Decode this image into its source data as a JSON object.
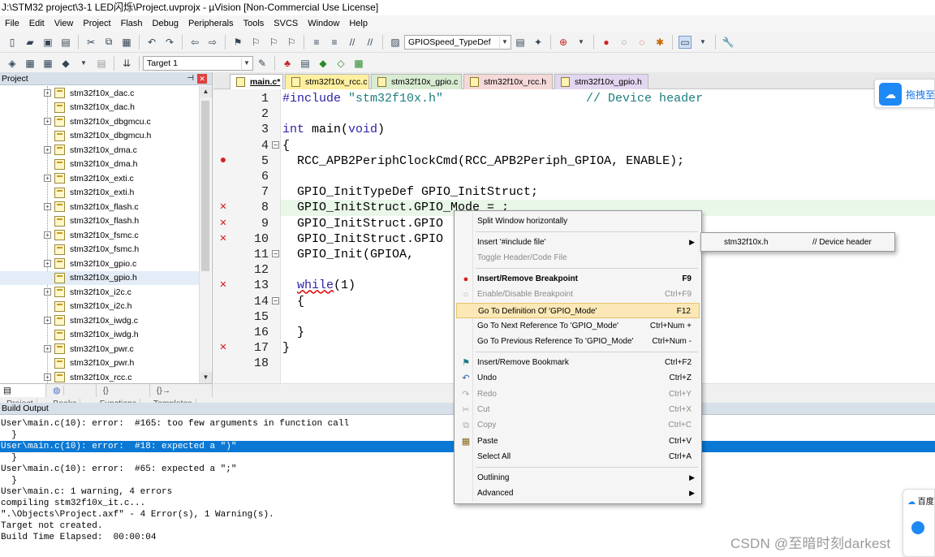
{
  "window": {
    "title": "J:\\STM32 project\\3-1 LED闪烁\\Project.uvprojx - µVision  [Non-Commercial Use License]"
  },
  "menu": [
    "File",
    "Edit",
    "View",
    "Project",
    "Flash",
    "Debug",
    "Peripherals",
    "Tools",
    "SVCS",
    "Window",
    "Help"
  ],
  "toolbar": {
    "find_combo": "GPIOSpeed_TypeDef",
    "target_combo": "Target 1"
  },
  "project_pane": {
    "title": "Project",
    "files": [
      {
        "name": "stm32f10x_dac.c",
        "expandable": true
      },
      {
        "name": "stm32f10x_dac.h",
        "expandable": false
      },
      {
        "name": "stm32f10x_dbgmcu.c",
        "expandable": true
      },
      {
        "name": "stm32f10x_dbgmcu.h",
        "expandable": false
      },
      {
        "name": "stm32f10x_dma.c",
        "expandable": true
      },
      {
        "name": "stm32f10x_dma.h",
        "expandable": false
      },
      {
        "name": "stm32f10x_exti.c",
        "expandable": true
      },
      {
        "name": "stm32f10x_exti.h",
        "expandable": false
      },
      {
        "name": "stm32f10x_flash.c",
        "expandable": true
      },
      {
        "name": "stm32f10x_flash.h",
        "expandable": false
      },
      {
        "name": "stm32f10x_fsmc.c",
        "expandable": true
      },
      {
        "name": "stm32f10x_fsmc.h",
        "expandable": false
      },
      {
        "name": "stm32f10x_gpio.c",
        "expandable": true
      },
      {
        "name": "stm32f10x_gpio.h",
        "expandable": false
      },
      {
        "name": "stm32f10x_i2c.c",
        "expandable": true
      },
      {
        "name": "stm32f10x_i2c.h",
        "expandable": false
      },
      {
        "name": "stm32f10x_iwdg.c",
        "expandable": true
      },
      {
        "name": "stm32f10x_iwdg.h",
        "expandable": false
      },
      {
        "name": "stm32f10x_pwr.c",
        "expandable": true
      },
      {
        "name": "stm32f10x_pwr.h",
        "expandable": false
      },
      {
        "name": "stm32f10x_rcc.c",
        "expandable": true
      }
    ],
    "tabs": [
      "Project",
      "Books",
      "{} Functions",
      "{}→ Templates"
    ]
  },
  "editor_tabs": [
    {
      "label": "main.c*",
      "color": "#e9e0f5",
      "active": true
    },
    {
      "label": "stm32f10x_rcc.c",
      "color": "#fff0a0",
      "active": false
    },
    {
      "label": "stm32f10x_gpio.c",
      "color": "#d8ecd2",
      "active": false
    },
    {
      "label": "stm32f10x_rcc.h",
      "color": "#f5d8d8",
      "active": false
    },
    {
      "label": "stm32f10x_gpio.h",
      "color": "#e2d6f0",
      "active": false
    }
  ],
  "code": {
    "line_numbers": [
      "1",
      "2",
      "3",
      "4",
      "5",
      "6",
      "7",
      "8",
      "9",
      "10",
      "11",
      "12",
      "13",
      "14",
      "15",
      "16",
      "17",
      "18"
    ],
    "l1_a": "#include ",
    "l1_b": "\"stm32f10x.h\"",
    "l1_c": "// Device header",
    "l3_a": "int",
    "l3_b": " main(",
    "l3_c": "void",
    "l3_d": ")",
    "l4": "{",
    "l5": "  RCC_APB2PeriphClockCmd(RCC_APB2Periph_GPIOA, ENABLE);",
    "l7": "  GPIO_InitTypeDef GPIO_InitStruct;",
    "l8": "  GPIO_InitStruct.GPIO_Mode = ;",
    "l9": "  GPIO_InitStruct.GPIO",
    "l10": "  GPIO_InitStruct.GPIO",
    "l11": "  GPIO_Init(GPIOA,",
    "l13_a": "  ",
    "l13_b": "while",
    "l13_c": "(1)",
    "l14": "  {",
    "l16": "  }",
    "l17": "}"
  },
  "context_menu": {
    "items": [
      {
        "label": "Split Window horizontally",
        "shortcut": "",
        "disabled": false,
        "bold": false
      },
      {
        "label": "Insert '#include file'",
        "shortcut": "",
        "disabled": false,
        "bold": false,
        "submenu": true
      },
      {
        "label": "Toggle Header/Code File",
        "shortcut": "",
        "disabled": true,
        "bold": false
      },
      {
        "label": "Insert/Remove Breakpoint",
        "shortcut": "F9",
        "disabled": false,
        "bold": true
      },
      {
        "label": "Enable/Disable Breakpoint",
        "shortcut": "Ctrl+F9",
        "disabled": true,
        "bold": false
      },
      {
        "label": "Go To Definition Of 'GPIO_Mode'",
        "shortcut": "F12",
        "disabled": false,
        "bold": false,
        "hover": true
      },
      {
        "label": "Go To Next Reference To 'GPIO_Mode'",
        "shortcut": "Ctrl+Num +",
        "disabled": false,
        "bold": false
      },
      {
        "label": "Go To Previous Reference To 'GPIO_Mode'",
        "shortcut": "Ctrl+Num -",
        "disabled": false,
        "bold": false
      },
      {
        "label": "Insert/Remove Bookmark",
        "shortcut": "Ctrl+F2",
        "disabled": false,
        "bold": false
      },
      {
        "label": "Undo",
        "shortcut": "Ctrl+Z",
        "disabled": false,
        "bold": false
      },
      {
        "label": "Redo",
        "shortcut": "Ctrl+Y",
        "disabled": true,
        "bold": false
      },
      {
        "label": "Cut",
        "shortcut": "Ctrl+X",
        "disabled": true,
        "bold": false
      },
      {
        "label": "Copy",
        "shortcut": "Ctrl+C",
        "disabled": true,
        "bold": false
      },
      {
        "label": "Paste",
        "shortcut": "Ctrl+V",
        "disabled": false,
        "bold": false
      },
      {
        "label": "Select All",
        "shortcut": "Ctrl+A",
        "disabled": false,
        "bold": false
      },
      {
        "label": "Outlining",
        "shortcut": "",
        "disabled": false,
        "bold": false,
        "submenu": true
      },
      {
        "label": "Advanced",
        "shortcut": "",
        "disabled": false,
        "bold": false,
        "submenu": true
      }
    ]
  },
  "include_submenu": {
    "file": "stm32f10x.h",
    "desc": "// Device header"
  },
  "baidu_widget": {
    "label": "拖拽至"
  },
  "build_output": {
    "title": "Build Output",
    "lines": [
      "User\\main.c(10): error:  #165: too few arguments in function call",
      "  }",
      "User\\main.c(10): error:  #18: expected a \")\"",
      "  }",
      "User\\main.c(10): error:  #65: expected a \";\"",
      "  }",
      "User\\main.c: 1 warning, 4 errors",
      "compiling stm32f10x_it.c...",
      "\".\\Objects\\Project.axf\" - 4 Error(s), 1 Warning(s).",
      "Target not created.",
      "Build Time Elapsed:  00:00:04"
    ]
  },
  "side_card": {
    "label": "百度"
  },
  "watermark": "CSDN @至暗时刻darkest"
}
